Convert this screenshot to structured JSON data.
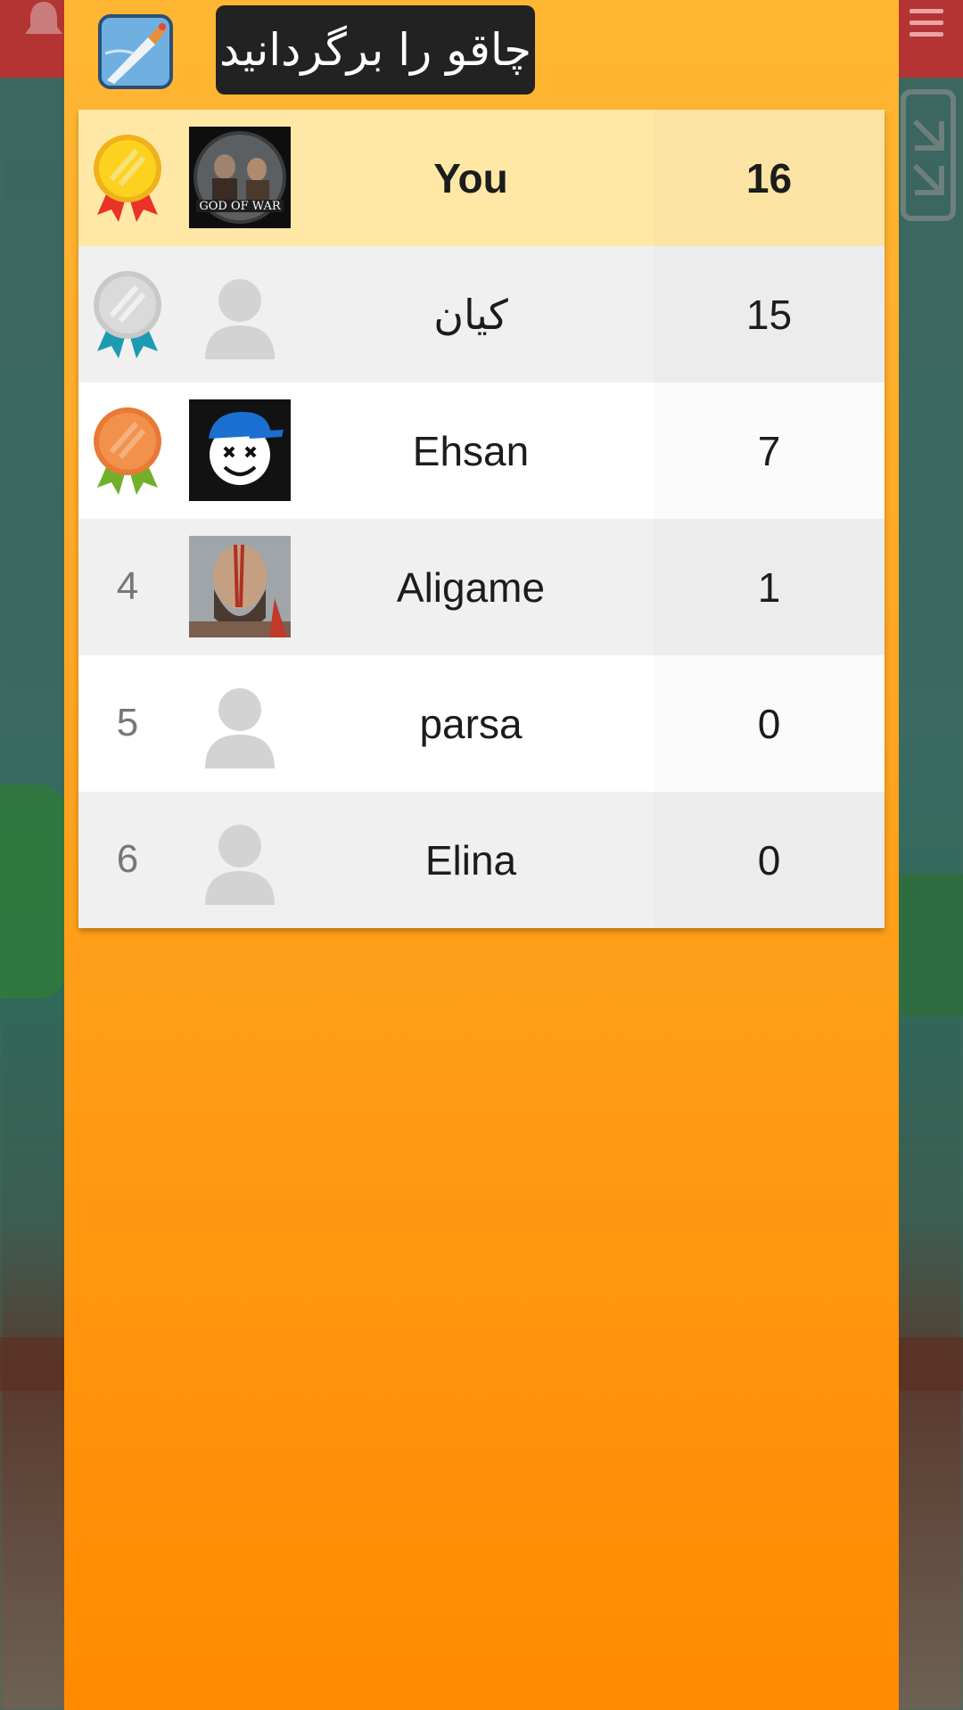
{
  "header": {
    "title": "چاقو را برگردانید",
    "game_icon": "knife-game-icon"
  },
  "background": {
    "icons": [
      "bell-icon",
      "hamburger-menu-icon",
      "expand-icon"
    ]
  },
  "leaderboard": {
    "rows": [
      {
        "rank": "1",
        "medal": "gold-medal-icon",
        "avatar": "god-of-war-avatar",
        "name": "You",
        "score": "16"
      },
      {
        "rank": "2",
        "medal": "silver-medal-icon",
        "avatar": "default-user-avatar",
        "name": "کیان",
        "score": "15"
      },
      {
        "rank": "3",
        "medal": "bronze-medal-icon",
        "avatar": "smiley-cap-avatar",
        "name": "Ehsan",
        "score": "7"
      },
      {
        "rank": "4",
        "medal": "",
        "avatar": "kratos-avatar",
        "name": "Aligame",
        "score": "1"
      },
      {
        "rank": "5",
        "medal": "",
        "avatar": "default-user-avatar",
        "name": "parsa",
        "score": "0"
      },
      {
        "rank": "6",
        "medal": "",
        "avatar": "default-user-avatar",
        "name": "Elina",
        "score": "0"
      }
    ]
  },
  "colors": {
    "panel_top": "#ffb733",
    "panel_bottom": "#ff8a00",
    "current_user_row": "#ffe8a6",
    "gold": "#f7c51a",
    "silver": "#d2d2d2",
    "bronze": "#ee8740"
  }
}
